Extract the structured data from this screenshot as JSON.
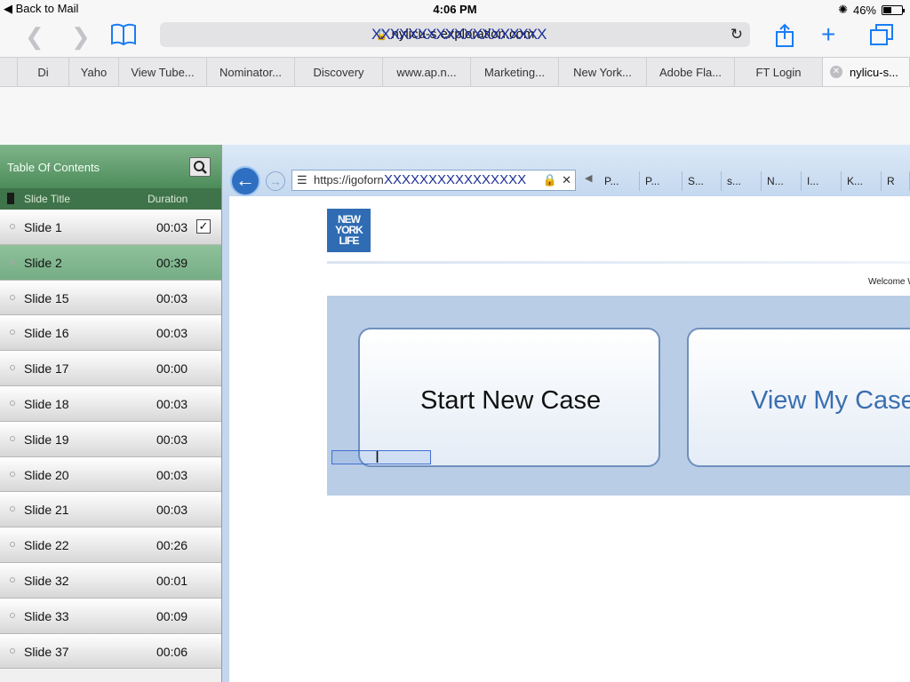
{
  "status_bar": {
    "back_label": "Back to Mail",
    "time": "4:06 PM",
    "battery": "46%",
    "battery_level": 0.46
  },
  "toolbar": {
    "address_text": "nylicu-s.exploration.com",
    "address_scribble": "XXXXXXXXXXXXXXXXXXX",
    "icons": [
      "back-arrow-icon",
      "forward-arrow-icon",
      "bookmarks-icon",
      "reload-icon",
      "share-icon",
      "plus-icon",
      "tabs-icon"
    ]
  },
  "tabs": [
    {
      "label": ""
    },
    {
      "label": "Di"
    },
    {
      "label": "Yaho"
    },
    {
      "label": "View Tube..."
    },
    {
      "label": "Nominator..."
    },
    {
      "label": "Discovery"
    },
    {
      "label": "www.ap.n..."
    },
    {
      "label": "Marketing..."
    },
    {
      "label": "New York..."
    },
    {
      "label": "Adobe Fla..."
    },
    {
      "label": "FT Login"
    },
    {
      "label": "nylicu-s..."
    }
  ],
  "toc": {
    "title": "Table Of Contents",
    "col_title": "Slide Title",
    "col_duration": "Duration",
    "rows": [
      {
        "title": "Slide 1",
        "duration": "00:03",
        "checked": true
      },
      {
        "title": "Slide 2",
        "duration": "00:39",
        "selected": true
      },
      {
        "title": "Slide 15",
        "duration": "00:03"
      },
      {
        "title": "Slide 16",
        "duration": "00:03"
      },
      {
        "title": "Slide 17",
        "duration": "00:00"
      },
      {
        "title": "Slide 18",
        "duration": "00:03"
      },
      {
        "title": "Slide 19",
        "duration": "00:03"
      },
      {
        "title": "Slide 20",
        "duration": "00:03"
      },
      {
        "title": "Slide 21",
        "duration": "00:03"
      },
      {
        "title": "Slide 22",
        "duration": "00:26"
      },
      {
        "title": "Slide 32",
        "duration": "00:01"
      },
      {
        "title": "Slide 33",
        "duration": "00:09"
      },
      {
        "title": "Slide 37",
        "duration": "00:06"
      }
    ]
  },
  "ie": {
    "url": "https://igoforn",
    "url_scribble": "XXXXXXXXXXXXXXXX",
    "tabs": [
      "P...",
      "P...",
      "S...",
      "s...",
      "N...",
      "I...",
      "K...",
      "R"
    ]
  },
  "page": {
    "logo": "NEW YORK LIFE",
    "welcome": "Welcome W",
    "start_case": "Start New Case",
    "view_case": "View My Case"
  },
  "colors": {
    "toc_header": "#5d9a6a",
    "selected_row": "#82b890",
    "logo_blue": "#2f6cb3",
    "view_case_text": "#3a6fb0"
  }
}
